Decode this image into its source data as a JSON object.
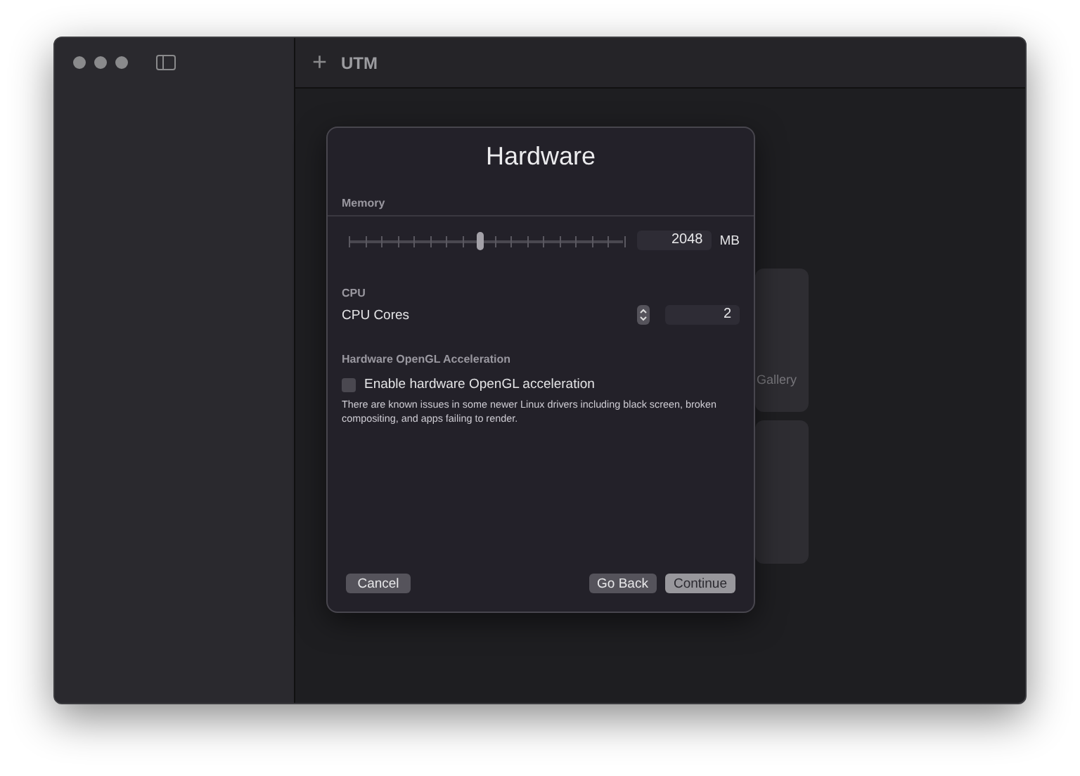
{
  "window": {
    "title": "UTM",
    "add_symbol": "+"
  },
  "background_card": {
    "label": "Gallery"
  },
  "dialog": {
    "title": "Hardware",
    "memory": {
      "heading": "Memory",
      "level": 0.47,
      "value": "2048",
      "unit": "MB"
    },
    "cpu": {
      "heading": "CPU",
      "label": "CPU Cores",
      "value": "2"
    },
    "opengl": {
      "heading": "Hardware OpenGL Acceleration",
      "checkbox_label": "Enable hardware OpenGL acceleration",
      "checked": false,
      "note": "There are known issues in some newer Linux drivers including black screen, broken compositing, and apps failing to render."
    },
    "buttons": [
      {
        "label": "Cancel",
        "kind": "secondary"
      },
      {
        "label": "Go Back",
        "kind": "secondary"
      },
      {
        "label": "Continue",
        "kind": "primary"
      }
    ]
  }
}
